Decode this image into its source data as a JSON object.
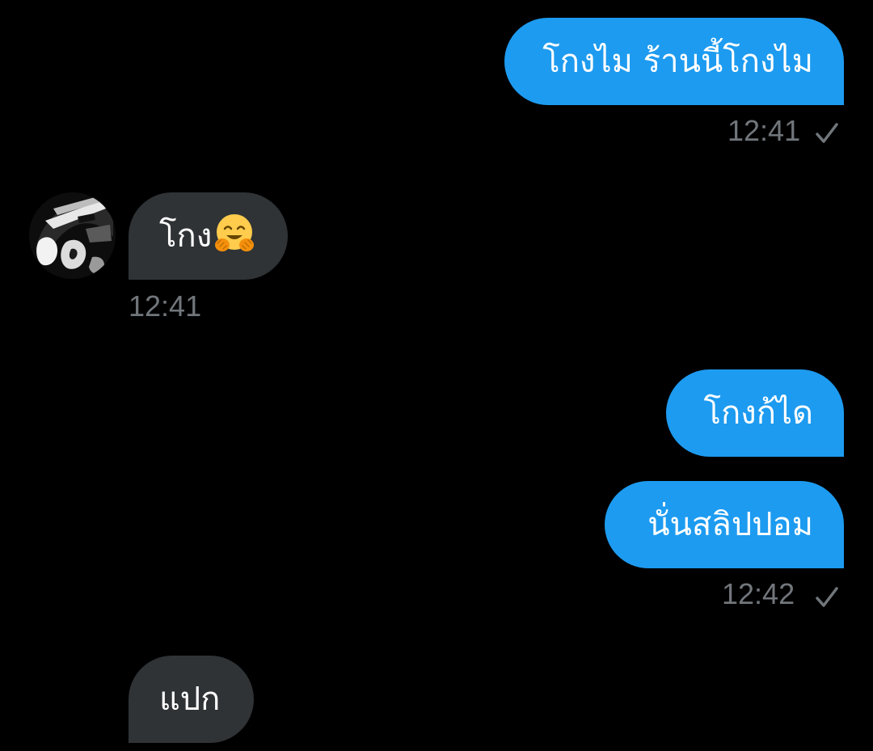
{
  "messages": [
    {
      "text": "โกงไม ร้านนี้โกงไม",
      "direction": "outgoing"
    },
    {
      "text": "โกง",
      "direction": "incoming",
      "emoji": "hugging-face-emoji"
    },
    {
      "text": "โกงก้ได",
      "direction": "outgoing"
    },
    {
      "text": "นั่นสลิปปอม",
      "direction": "outgoing"
    },
    {
      "text": "แปก",
      "direction": "incoming"
    }
  ],
  "timestamps": {
    "t1": "12:41",
    "t2": "12:41",
    "t3": "12:42"
  },
  "icons": {
    "read_receipt": "checkmark-icon",
    "avatar": "user-avatar"
  },
  "colors": {
    "background": "#000000",
    "outgoing_bubble": "#1d9bf0",
    "incoming_bubble": "#2f3336",
    "timestamp": "#71767b",
    "text": "#ffffff"
  }
}
